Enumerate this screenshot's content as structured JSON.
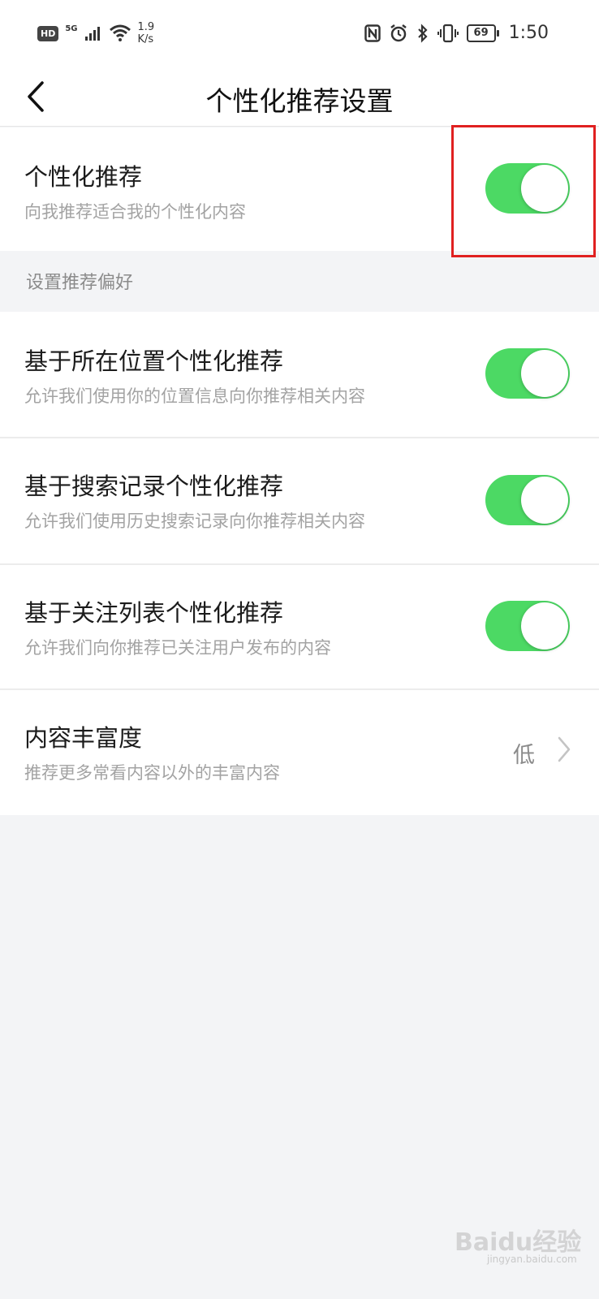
{
  "status_bar": {
    "hd": "HD",
    "network": "5G",
    "speed_value": "1.9",
    "speed_unit": "K/s",
    "battery": "69",
    "time": "1:50"
  },
  "nav": {
    "title": "个性化推荐设置"
  },
  "main_toggle": {
    "title": "个性化推荐",
    "subtitle": "向我推荐适合我的个性化内容",
    "on": true
  },
  "section": {
    "header": "设置推荐偏好",
    "items": [
      {
        "title": "基于所在位置个性化推荐",
        "subtitle": "允许我们使用你的位置信息向你推荐相关内容",
        "on": true
      },
      {
        "title": "基于搜索记录个性化推荐",
        "subtitle": "允许我们使用历史搜索记录向你推荐相关内容",
        "on": true
      },
      {
        "title": "基于关注列表个性化推荐",
        "subtitle": "允许我们向你推荐已关注用户发布的内容",
        "on": true
      }
    ]
  },
  "richness": {
    "title": "内容丰富度",
    "subtitle": "推荐更多常看内容以外的丰富内容",
    "value": "低"
  },
  "watermark": {
    "brand": "Baidu经验",
    "domain": "jingyan.baidu.com"
  },
  "colors": {
    "toggle_on": "#4cd964",
    "highlight": "#e02020",
    "background": "#f3f4f6"
  }
}
